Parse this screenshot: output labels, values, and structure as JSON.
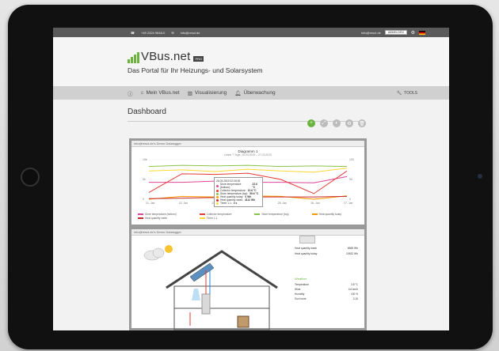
{
  "topbar": {
    "phone": "+49 2324 9648-0",
    "email": "info@resol.de",
    "login_email": "info@resol.de",
    "account_button": "ABMELDEN"
  },
  "brand": {
    "name": "VBus.net",
    "badge": "PRO",
    "tagline": "Das Portal für Ihr Heizungs- und Solarsystem",
    "accent": "#6cb33e"
  },
  "nav": {
    "items": [
      {
        "label": "Mein VBus.net",
        "icon": "home-icon"
      },
      {
        "label": "Visualisierung",
        "icon": "chart-icon"
      },
      {
        "label": "Überwachung",
        "icon": "bell-icon"
      }
    ],
    "tools": "TOOLS"
  },
  "page": {
    "title": "Dashboard"
  },
  "panel1": {
    "header": "info@resol.de's Demo Datalogger",
    "chart_title": "Diagramm 1",
    "chart_subtitle": "Letzte 7 Tage, 20.03.2019 – 27.03.2019",
    "tooltip": {
      "date": "26.03.2019 02:00:00",
      "rows": [
        {
          "label": "Store temperature (bottom):",
          "value": "22.6 °C",
          "color": "#e0449a"
        },
        {
          "label": "Collector temperature:",
          "value": "10.6 °C",
          "color": "#e53935"
        },
        {
          "label": "Store temperature (top):",
          "value": "59.6 °C",
          "color": "#8bc34a"
        },
        {
          "label": "Heat quantity today:",
          "value": "0 Wh",
          "color": "#ff9800"
        },
        {
          "label": "Heat quantity week:",
          "value": "4112 Wh",
          "color": "#c62828"
        },
        {
          "label": "Timer 1.1:",
          "value": "0 s",
          "color": "#fdd835"
        }
      ]
    }
  },
  "chart_data": {
    "type": "line",
    "title": "Diagramm 1",
    "subtitle": "Letzte 7 Tage, 20.03.2019 – 27.03.2019",
    "x": [
      "21. Jan",
      "22. Jan",
      "23. Jan",
      "24. Jan",
      "25. Jan",
      "26. Jan",
      "27. Jan"
    ],
    "series": [
      {
        "name": "Store temperature (bottom)",
        "color": "#e0449a",
        "values": [
          30,
          30,
          32,
          30,
          30,
          29,
          40
        ]
      },
      {
        "name": "Collector temperature",
        "color": "#e53935",
        "values": [
          12,
          45,
          44,
          46,
          35,
          10,
          50
        ]
      },
      {
        "name": "Store temperature (top)",
        "color": "#8bc34a",
        "values": [
          58,
          60,
          59,
          60,
          58,
          59,
          58
        ]
      },
      {
        "name": "Heat quantity today",
        "color": "#ff9800",
        "values": [
          0,
          5,
          4,
          6,
          5,
          0,
          6
        ]
      },
      {
        "name": "Heat quantity week",
        "color": "#c62828",
        "values": [
          1,
          2,
          3,
          4,
          4,
          4,
          5
        ]
      },
      {
        "name": "Timer 1.1",
        "color": "#fdd835",
        "values": [
          50,
          52,
          49,
          53,
          50,
          48,
          55
        ]
      }
    ],
    "yaxis_left_ticks": [
      "0",
      "5k",
      "10k"
    ],
    "yaxis_right_ticks": [
      "0",
      "50",
      "100"
    ]
  },
  "panel2": {
    "header": "info@resol.de's Demo Datalogger",
    "stats": [
      {
        "label": "Heat quantity week",
        "value": "6565 Wh"
      },
      {
        "label": "Heat quantity today",
        "value": "10632 Wh"
      }
    ],
    "weather_title": "Weather",
    "weather": [
      {
        "label": "Temperature",
        "value": "3.8 °C"
      },
      {
        "label": "Wind",
        "value": "4.6 km/h"
      },
      {
        "label": "Humidity",
        "value": "100 %"
      },
      {
        "label": "Sun hours",
        "value": "3.16"
      }
    ]
  }
}
